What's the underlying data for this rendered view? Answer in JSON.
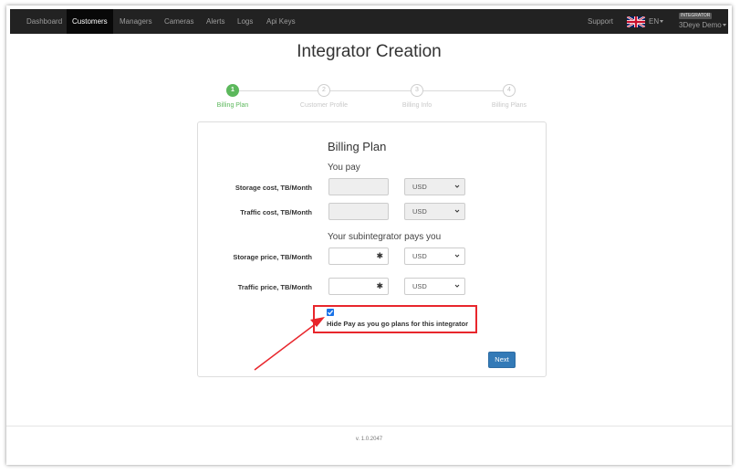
{
  "navbar": {
    "items": [
      {
        "label": "Dashboard",
        "active": false
      },
      {
        "label": "Customers",
        "active": true
      },
      {
        "label": "Managers",
        "active": false
      },
      {
        "label": "Cameras",
        "active": false
      },
      {
        "label": "Alerts",
        "active": false
      },
      {
        "label": "Logs",
        "active": false
      },
      {
        "label": "Api Keys",
        "active": false
      }
    ],
    "support_label": "Support",
    "language_label": "EN",
    "language_flag_icon": "uk-flag-icon",
    "role_badge": "INTEGRATOR",
    "user_name": "3Deye Demo"
  },
  "page": {
    "title": "Integrator Creation"
  },
  "stepper": {
    "steps": [
      {
        "number": "1",
        "label": "Billing Plan",
        "active": true
      },
      {
        "number": "2",
        "label": "Customer Profile",
        "active": false
      },
      {
        "number": "3",
        "label": "Billing Info",
        "active": false
      },
      {
        "number": "4",
        "label": "Billing Plans",
        "active": false
      }
    ],
    "active_color": "#5cb85c"
  },
  "form": {
    "title": "Billing Plan",
    "you_pay_label": "You pay",
    "subintegrator_label": "Your subintegrator pays you",
    "rows": [
      {
        "label": "Storage cost, TB/Month",
        "value": "",
        "currency": "USD",
        "disabled": true
      },
      {
        "label": "Traffic cost, TB/Month",
        "value": "",
        "currency": "USD",
        "disabled": true
      },
      {
        "label": "Storage price, TB/Month",
        "value": "",
        "required_mark": "✱",
        "currency": "USD",
        "disabled": false
      },
      {
        "label": "Traffic price, TB/Month",
        "value": "",
        "required_mark": "✱",
        "currency": "USD",
        "disabled": false
      }
    ],
    "checkbox": {
      "checked": true,
      "label": "Hide Pay as you go plans for this integrator"
    },
    "next_label": "Next"
  },
  "annotation": {
    "highlight_color": "#e8262c"
  },
  "footer": {
    "version": "v. 1.0.2047"
  }
}
